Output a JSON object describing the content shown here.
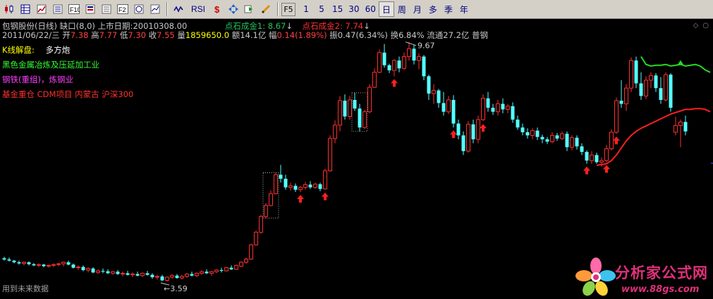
{
  "toolbar": {
    "icons": [
      "kline-icon",
      "table-icon",
      "line-chart-icon",
      "list-icon",
      "f10-icon",
      "stock-list-icon",
      "f1-icon",
      "f2-icon",
      "info-icon",
      "overlay-icon"
    ],
    "f10_label": "F10",
    "f2_label": "F2",
    "indicator_label": "RSI",
    "f5_label": "F5",
    "periods": [
      "1",
      "5",
      "15",
      "30",
      "60",
      "日",
      "周",
      "月",
      "多",
      "季",
      "年"
    ],
    "active_period": "日"
  },
  "info": {
    "line1": {
      "stock": "包钢股份(日线)",
      "gap": "缺口(8,0)",
      "listing_label": "上市日期:",
      "listing_date": "20010308.00",
      "gold1": "点石成金1: 8.67",
      "gold2": "点石成金2: 7.74"
    },
    "line2": {
      "date": "2011/06/22/三",
      "open_label": "开",
      "open": "7.38",
      "high_label": "高",
      "high": "7.77",
      "low_label": "低",
      "low": "7.30",
      "close_label": "收",
      "close": "7.55",
      "vol_label": "量",
      "vol": "1859650.0",
      "amount": "额14.1亿",
      "change_label": "幅",
      "change": "0.14(1.89%)",
      "amplitude": "振0.47(6.34%)",
      "turnover": "换6.84%",
      "float_cap": "流通27.2亿",
      "industry": "普钢"
    }
  },
  "labels": {
    "kline_title": "K线解盘:",
    "kline_value": "多方炮",
    "sector1": "黑色金属冶炼及压延加工业",
    "sector2": "钢铁(重组)，炼钢业",
    "sector3": "基金重仓 CDM项目 内蒙古 沪深300"
  },
  "chart_annotations": {
    "high_label": "9.67",
    "low_label": "3.59"
  },
  "watermark": "用到未来数据",
  "logo": {
    "title": "分析家公式网",
    "url": "www.88gs.com"
  },
  "colors": {
    "up": "#ff3030",
    "down": "#54ffff",
    "line_green": "#22dd22",
    "line_red": "#ff2020",
    "background": "#000000"
  },
  "chart_data": {
    "type": "candlestick",
    "ylim": [
      3.2,
      10.2
    ],
    "candles": [
      [
        4.18,
        4.22,
        4.12,
        4.15
      ],
      [
        4.15,
        4.2,
        4.1,
        4.12
      ],
      [
        4.12,
        4.14,
        4.05,
        4.08
      ],
      [
        4.08,
        4.12,
        4.02,
        4.05
      ],
      [
        4.05,
        4.1,
        4.0,
        4.08
      ],
      [
        4.08,
        4.1,
        4.0,
        4.03
      ],
      [
        4.03,
        4.06,
        3.98,
        4.0
      ],
      [
        4.0,
        4.05,
        3.96,
        4.02
      ],
      [
        4.02,
        4.04,
        3.95,
        3.98
      ],
      [
        3.98,
        4.02,
        3.94,
        4.0
      ],
      [
        4.0,
        4.05,
        3.96,
        4.02
      ],
      [
        4.02,
        4.06,
        3.98,
        4.04
      ],
      [
        4.04,
        4.1,
        3.98,
        4.08
      ],
      [
        4.08,
        4.12,
        4.0,
        4.02
      ],
      [
        4.02,
        4.05,
        3.92,
        3.94
      ],
      [
        3.94,
        4.0,
        3.88,
        3.96
      ],
      [
        3.96,
        4.0,
        3.85,
        3.88
      ],
      [
        3.88,
        3.95,
        3.82,
        3.92
      ],
      [
        3.92,
        3.95,
        3.8,
        3.82
      ],
      [
        3.82,
        3.9,
        3.78,
        3.86
      ],
      [
        3.86,
        3.92,
        3.8,
        3.85
      ],
      [
        3.85,
        3.9,
        3.78,
        3.8
      ],
      [
        3.8,
        3.86,
        3.76,
        3.84
      ],
      [
        3.84,
        3.88,
        3.76,
        3.78
      ],
      [
        3.78,
        3.84,
        3.72,
        3.8
      ],
      [
        3.8,
        3.86,
        3.74,
        3.76
      ],
      [
        3.76,
        3.82,
        3.7,
        3.78
      ],
      [
        3.78,
        3.84,
        3.72,
        3.74
      ],
      [
        3.74,
        3.82,
        3.7,
        3.8
      ],
      [
        3.8,
        3.86,
        3.74,
        3.76
      ],
      [
        3.76,
        3.8,
        3.66,
        3.7
      ],
      [
        3.7,
        3.76,
        3.64,
        3.72
      ],
      [
        3.72,
        3.76,
        3.6,
        3.62
      ],
      [
        3.62,
        3.72,
        3.59,
        3.7
      ],
      [
        3.7,
        3.78,
        3.66,
        3.74
      ],
      [
        3.74,
        3.78,
        3.66,
        3.68
      ],
      [
        3.68,
        3.76,
        3.64,
        3.72
      ],
      [
        3.72,
        3.8,
        3.68,
        3.78
      ],
      [
        3.78,
        3.84,
        3.72,
        3.74
      ],
      [
        3.74,
        3.82,
        3.7,
        3.8
      ],
      [
        3.8,
        3.88,
        3.76,
        3.84
      ],
      [
        3.84,
        3.9,
        3.78,
        3.8
      ],
      [
        3.8,
        3.86,
        3.74,
        3.84
      ],
      [
        3.84,
        3.9,
        3.8,
        3.88
      ],
      [
        3.88,
        3.94,
        3.82,
        3.86
      ],
      [
        3.86,
        3.96,
        3.84,
        3.94
      ],
      [
        3.94,
        4.0,
        3.88,
        3.9
      ],
      [
        3.9,
        4.02,
        3.88,
        4.0
      ],
      [
        3.98,
        4.1,
        3.96,
        4.08
      ],
      [
        4.08,
        4.2,
        4.04,
        4.16
      ],
      [
        4.16,
        4.55,
        4.14,
        4.52
      ],
      [
        4.52,
        4.88,
        4.5,
        4.84
      ],
      [
        4.84,
        5.28,
        4.8,
        5.24
      ],
      [
        5.24,
        5.58,
        5.2,
        5.52
      ],
      [
        5.52,
        5.9,
        5.5,
        5.82
      ],
      [
        5.82,
        6.35,
        5.8,
        6.3
      ],
      [
        6.3,
        6.55,
        6.1,
        6.2
      ],
      [
        6.2,
        6.3,
        5.92,
        5.98
      ],
      [
        5.98,
        6.1,
        5.9,
        6.02
      ],
      [
        6.02,
        6.08,
        5.86,
        5.92
      ],
      [
        5.92,
        6.02,
        5.86,
        5.98
      ],
      [
        5.98,
        6.12,
        5.92,
        6.05
      ],
      [
        6.05,
        6.14,
        5.94,
        5.98
      ],
      [
        5.98,
        6.1,
        5.94,
        6.06
      ],
      [
        6.06,
        6.1,
        5.88,
        5.94
      ],
      [
        5.94,
        6.45,
        5.92,
        6.4
      ],
      [
        6.4,
        7.3,
        6.38,
        7.22
      ],
      [
        7.22,
        7.68,
        7.1,
        7.56
      ],
      [
        7.56,
        8.3,
        7.4,
        8.18
      ],
      [
        8.18,
        8.34,
        7.7,
        7.78
      ],
      [
        7.78,
        8.3,
        7.7,
        8.2
      ],
      [
        8.2,
        8.38,
        7.92,
        7.98
      ],
      [
        7.98,
        8.1,
        7.4,
        7.5
      ],
      [
        7.5,
        7.95,
        7.46,
        7.9
      ],
      [
        7.9,
        8.6,
        7.86,
        8.52
      ],
      [
        8.52,
        9.0,
        8.5,
        8.9
      ],
      [
        8.9,
        9.48,
        8.88,
        9.4
      ],
      [
        9.4,
        9.62,
        9.02,
        9.08
      ],
      [
        9.08,
        9.12,
        8.88,
        8.95
      ],
      [
        8.95,
        9.24,
        8.8,
        9.2
      ],
      [
        9.2,
        9.3,
        8.9,
        9.0
      ],
      [
        9.0,
        9.4,
        8.96,
        9.3
      ],
      [
        9.3,
        9.67,
        9.2,
        9.5
      ],
      [
        9.5,
        9.6,
        9.1,
        9.2
      ],
      [
        9.2,
        9.38,
        8.98,
        9.3
      ],
      [
        9.3,
        9.34,
        8.7,
        8.8
      ],
      [
        8.8,
        8.84,
        8.2,
        8.36
      ],
      [
        8.36,
        8.6,
        8.1,
        8.44
      ],
      [
        8.44,
        8.48,
        8.0,
        8.12
      ],
      [
        8.12,
        8.4,
        7.8,
        7.9
      ],
      [
        7.9,
        8.3,
        7.84,
        8.2
      ],
      [
        8.2,
        8.32,
        7.5,
        7.6
      ],
      [
        7.6,
        7.7,
        7.2,
        7.3
      ],
      [
        7.3,
        7.4,
        6.8,
        6.9
      ],
      [
        6.9,
        7.66,
        6.86,
        7.58
      ],
      [
        7.58,
        7.7,
        7.1,
        7.2
      ],
      [
        7.2,
        7.8,
        7.1,
        7.7
      ],
      [
        7.7,
        8.34,
        7.66,
        8.24
      ],
      [
        8.24,
        8.4,
        7.9,
        8.0
      ],
      [
        8.0,
        8.1,
        7.82,
        7.9
      ],
      [
        7.9,
        8.2,
        7.8,
        8.1
      ],
      [
        8.1,
        8.24,
        7.86,
        7.96
      ],
      [
        7.96,
        8.1,
        7.86,
        8.04
      ],
      [
        8.04,
        8.14,
        7.62,
        7.7
      ],
      [
        7.7,
        7.8,
        7.44,
        7.5
      ],
      [
        7.5,
        7.6,
        7.3,
        7.38
      ],
      [
        7.38,
        7.48,
        7.22,
        7.3
      ],
      [
        7.3,
        7.48,
        7.2,
        7.42
      ],
      [
        7.42,
        7.5,
        7.18,
        7.26
      ],
      [
        7.26,
        7.32,
        7.1,
        7.2
      ],
      [
        7.2,
        7.26,
        7.08,
        7.14
      ],
      [
        7.14,
        7.38,
        7.1,
        7.3
      ],
      [
        7.3,
        7.36,
        7.16,
        7.22
      ],
      [
        7.22,
        7.4,
        7.18,
        7.34
      ],
      [
        7.34,
        7.4,
        6.9,
        7.0
      ],
      [
        7.0,
        7.3,
        6.92,
        7.24
      ],
      [
        7.24,
        7.3,
        6.94,
        7.02
      ],
      [
        7.02,
        7.1,
        6.8,
        6.88
      ],
      [
        6.88,
        6.92,
        6.58,
        6.66
      ],
      [
        6.66,
        6.9,
        6.58,
        6.8
      ],
      [
        6.8,
        6.86,
        6.58,
        6.62
      ],
      [
        6.62,
        6.74,
        6.5,
        6.66
      ],
      [
        6.66,
        7.06,
        6.62,
        6.96
      ],
      [
        6.96,
        7.46,
        6.92,
        7.38
      ],
      [
        7.38,
        8.26,
        7.34,
        8.18
      ],
      [
        8.18,
        8.7,
        8.0,
        8.1
      ],
      [
        8.1,
        8.6,
        7.92,
        8.5
      ],
      [
        8.5,
        9.28,
        8.4,
        9.2
      ],
      [
        9.2,
        9.3,
        8.5,
        8.62
      ],
      [
        8.62,
        8.9,
        8.2,
        8.3
      ],
      [
        8.3,
        8.8,
        8.22,
        8.7
      ],
      [
        8.7,
        8.9,
        8.5,
        8.82
      ],
      [
        8.82,
        8.88,
        8.4,
        8.5
      ],
      [
        8.5,
        8.78,
        8.1,
        8.2
      ],
      [
        8.2,
        8.9,
        8.16,
        8.84
      ],
      [
        8.84,
        8.88,
        7.9,
        8.0
      ],
      [
        7.38,
        7.77,
        7.3,
        7.55
      ],
      [
        7.55,
        7.7,
        7.0,
        7.64
      ],
      [
        7.64,
        7.8,
        7.3,
        7.4
      ]
    ],
    "arrow_indices": [
      60,
      65,
      79,
      91,
      97,
      118,
      122,
      124
    ],
    "green_line": {
      "start_index": 129,
      "values": [
        9.3,
        9.1,
        9.06,
        9.08,
        9.08,
        9.1,
        9.06,
        9.08,
        9.1,
        9.06,
        9.08,
        9.1,
        9.06,
        8.96,
        8.9
      ]
    },
    "red_line": {
      "start_index": 120,
      "values": [
        6.54,
        6.56,
        6.58,
        6.66,
        6.8,
        6.98,
        7.16,
        7.3,
        7.4,
        7.48,
        7.54,
        7.6,
        7.66,
        7.72,
        7.78,
        7.84,
        7.88,
        7.92,
        7.96,
        7.96,
        7.98,
        7.98,
        7.96,
        7.9
      ]
    },
    "high_marker": {
      "index": 82,
      "value": 9.67
    },
    "low_marker": {
      "index": 32,
      "value": 3.59
    }
  }
}
